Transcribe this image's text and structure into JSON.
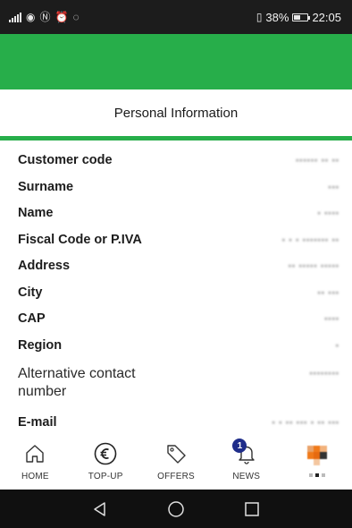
{
  "status_bar": {
    "battery_percent": "38%",
    "time": "22:05",
    "icons": [
      "lte-signal-icon",
      "eye-comfort-icon",
      "nfc-icon",
      "alarm-icon",
      "whatsapp-icon",
      "vibrate-icon",
      "battery-icon"
    ]
  },
  "colors": {
    "brand_green": "#27ae4a",
    "badge_blue": "#1f2d8a",
    "status_bar_bg": "#1c1c1c",
    "system_nav_bg": "#101010"
  },
  "page": {
    "title": "Personal Information"
  },
  "fields": [
    {
      "label": "Customer code",
      "value": "▪▪▪▪▪▪ ▪▪ ▪▪"
    },
    {
      "label": "Surname",
      "value": "▪▪▪"
    },
    {
      "label": "Name",
      "value": "▪ ▪▪▪▪"
    },
    {
      "label": "Fiscal Code or P.IVA",
      "value": "▪ ▪ ▪ ▪▪▪▪▪▪▪ ▪▪"
    },
    {
      "label": "Address",
      "value": "▪▪ ▪▪▪▪▪ ▪▪▪▪▪"
    },
    {
      "label": "City",
      "value": "▪▪ ▪▪▪"
    },
    {
      "label": "CAP",
      "value": "▪▪▪▪"
    },
    {
      "label": "Region",
      "value": "▪"
    },
    {
      "label": "Alternative contact number",
      "value": "▪▪▪▪▪▪▪▪"
    },
    {
      "label": "E-mail",
      "value": "▪ ▪ ▪▪ ▪▪▪ ▪ ▪▪ ▪▪▪"
    }
  ],
  "bottom_nav": {
    "items": [
      {
        "label": "HOME",
        "icon": "home-icon"
      },
      {
        "label": "TOP-UP",
        "icon": "euro-icon"
      },
      {
        "label": "OFFERS",
        "icon": "tag-icon"
      },
      {
        "label": "NEWS",
        "icon": "bell-icon",
        "badge": "1"
      },
      {
        "label": "",
        "icon": "more-icon"
      }
    ]
  },
  "system_nav": {
    "icons": [
      "back-icon",
      "home-circle-icon",
      "recents-icon"
    ]
  }
}
